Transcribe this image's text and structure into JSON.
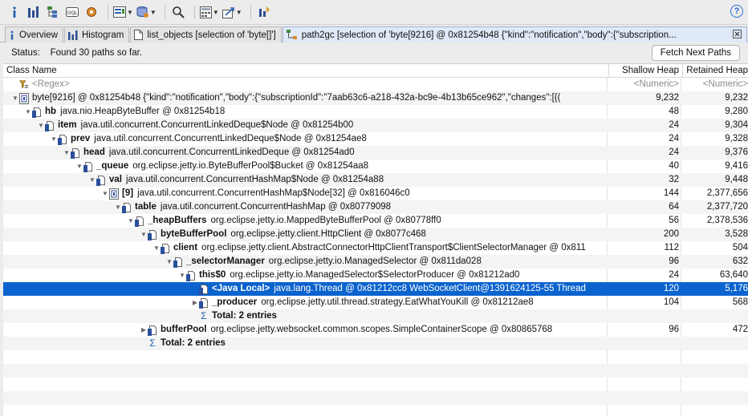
{
  "toolbar": {
    "items": [
      {
        "icon": "info-icon"
      },
      {
        "icon": "histogram-icon"
      },
      {
        "icon": "dominator-tree-icon"
      },
      {
        "icon": "oql-icon"
      },
      {
        "icon": "gear-icon"
      },
      {
        "icon": "query-browser-icon",
        "dropdown": true
      },
      {
        "icon": "heap-dump-icon",
        "dropdown": true
      },
      {
        "icon": "search-icon"
      },
      {
        "icon": "calculator-icon",
        "dropdown": true
      },
      {
        "icon": "export-icon",
        "dropdown": true
      },
      {
        "icon": "run-report-icon"
      }
    ],
    "help": "?"
  },
  "tabs": [
    {
      "label": "Overview",
      "icon": "info-icon"
    },
    {
      "label": "Histogram",
      "icon": "histogram-icon"
    },
    {
      "label": "list_objects  [selection of 'byte[]']",
      "icon": "document-icon"
    },
    {
      "label": "path2gc  [selection of 'byte[9216] @ 0x81254b48  {\"kind\":\"notification\",\"body\":{\"subscription...",
      "icon": "path-icon",
      "active": true
    }
  ],
  "status": {
    "label": "Status:",
    "text": "Found 30 paths so far.",
    "fetch_button": "Fetch Next Paths"
  },
  "columns": {
    "name": "Class Name",
    "shallow": "Shallow Heap",
    "retained": "Retained Heap"
  },
  "filter_row": {
    "name": "<Regex>",
    "shallow": "<Numeric>",
    "retained": "<Numeric>"
  },
  "rows": [
    {
      "indent": 0,
      "twisty": "▼",
      "icon": "array",
      "field": "",
      "desc": "byte[9216] @ 0x81254b48  {\"kind\":\"notification\",\"body\":{\"subscriptionId\":\"7aab63c6-a218-432a-bc9e-4b13b65ce962\",\"changes\":[{(",
      "shallow": "9,232",
      "retained": "9,232"
    },
    {
      "indent": 1,
      "twisty": "▼",
      "icon": "obj",
      "field": "hb",
      "desc": "java.nio.HeapByteBuffer @ 0x81254b18",
      "shallow": "48",
      "retained": "9,280"
    },
    {
      "indent": 2,
      "twisty": "▼",
      "icon": "obj",
      "field": "item",
      "desc": "java.util.concurrent.ConcurrentLinkedDeque$Node @ 0x81254b00",
      "shallow": "24",
      "retained": "9,304"
    },
    {
      "indent": 3,
      "twisty": "▼",
      "icon": "obj",
      "field": "prev",
      "desc": "java.util.concurrent.ConcurrentLinkedDeque$Node @ 0x81254ae8",
      "shallow": "24",
      "retained": "9,328"
    },
    {
      "indent": 4,
      "twisty": "▼",
      "icon": "obj",
      "field": "head",
      "desc": "java.util.concurrent.ConcurrentLinkedDeque @ 0x81254ad0",
      "shallow": "24",
      "retained": "9,376"
    },
    {
      "indent": 5,
      "twisty": "▼",
      "icon": "obj",
      "field": "_queue",
      "desc": "org.eclipse.jetty.io.ByteBufferPool$Bucket @ 0x81254aa8",
      "shallow": "40",
      "retained": "9,416"
    },
    {
      "indent": 6,
      "twisty": "▼",
      "icon": "obj",
      "field": "val",
      "desc": "java.util.concurrent.ConcurrentHashMap$Node @ 0x81254a88",
      "shallow": "32",
      "retained": "9,448"
    },
    {
      "indent": 7,
      "twisty": "▼",
      "icon": "array",
      "field": "[9]",
      "desc": "java.util.concurrent.ConcurrentHashMap$Node[32] @ 0x816046c0",
      "shallow": "144",
      "retained": "2,377,656"
    },
    {
      "indent": 8,
      "twisty": "▼",
      "icon": "obj",
      "field": "table",
      "desc": "java.util.concurrent.ConcurrentHashMap @ 0x80779098",
      "shallow": "64",
      "retained": "2,377,720"
    },
    {
      "indent": 9,
      "twisty": "▼",
      "icon": "obj",
      "field": "_heapBuffers",
      "desc": "org.eclipse.jetty.io.MappedByteBufferPool @ 0x80778ff0",
      "shallow": "56",
      "retained": "2,378,536"
    },
    {
      "indent": 10,
      "twisty": "▼",
      "icon": "obj",
      "field": "byteBufferPool",
      "desc": "org.eclipse.jetty.client.HttpClient @ 0x8077c468",
      "shallow": "200",
      "retained": "3,528"
    },
    {
      "indent": 11,
      "twisty": "▼",
      "icon": "obj",
      "field": "client",
      "desc": "org.eclipse.jetty.client.AbstractConnectorHttpClientTransport$ClientSelectorManager @ 0x811",
      "shallow": "112",
      "retained": "504"
    },
    {
      "indent": 12,
      "twisty": "▼",
      "icon": "obj",
      "field": "_selectorManager",
      "desc": "org.eclipse.jetty.io.ManagedSelector @ 0x811da028",
      "shallow": "96",
      "retained": "632"
    },
    {
      "indent": 13,
      "twisty": "▼",
      "icon": "obj",
      "field": "this$0",
      "desc": "org.eclipse.jetty.io.ManagedSelector$SelectorProducer @ 0x81212ad0",
      "shallow": "24",
      "retained": "63,640"
    },
    {
      "indent": 14,
      "twisty": "",
      "icon": "obj",
      "field": "<Java Local>",
      "desc": "java.lang.Thread @ 0x81212cc8  WebSocketClient@1391624125-55 Thread",
      "shallow": "120",
      "retained": "5,176",
      "selected": true
    },
    {
      "indent": 14,
      "twisty": "▶",
      "icon": "obj",
      "field": "_producer",
      "desc": "org.eclipse.jetty.util.thread.strategy.EatWhatYouKill @ 0x81212ae8",
      "shallow": "104",
      "retained": "568"
    },
    {
      "indent": 14,
      "twisty": "",
      "icon": "sigma",
      "field": "Total: 2 entries",
      "desc": "",
      "shallow": "",
      "retained": ""
    },
    {
      "indent": 10,
      "twisty": "▶",
      "icon": "obj",
      "field": "bufferPool",
      "desc": "org.eclipse.jetty.websocket.common.scopes.SimpleContainerScope @ 0x80865768",
      "shallow": "96",
      "retained": "472"
    },
    {
      "indent": 10,
      "twisty": "",
      "icon": "sigma",
      "field": "Total: 2 entries",
      "desc": "",
      "shallow": "",
      "retained": ""
    }
  ]
}
